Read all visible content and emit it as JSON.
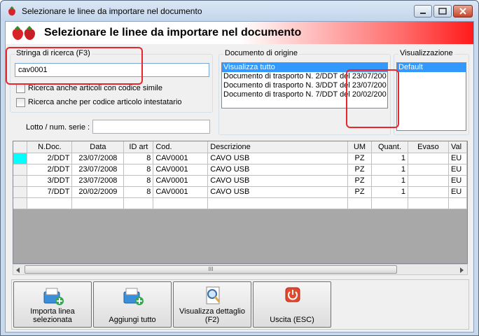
{
  "window": {
    "title": "Selezionare le linee da importare nel documento"
  },
  "banner": {
    "title": "Selezionare le linee da importare nel documento"
  },
  "search": {
    "label": "Stringa di ricerca (F3)",
    "value": "cav0001",
    "option1": "Ricerca anche articoli con codice simile",
    "option2": "Ricerca anche per codice articolo intestatario",
    "lot_label": "Lotto / num. serie :",
    "lot_value": ""
  },
  "origin": {
    "label": "Documento di origine",
    "items": [
      "Visualizza tutto",
      "Documento di trasporto N. 2/DDT del 23/07/200",
      "Documento di trasporto N. 3/DDT del 23/07/200",
      "Documento di trasporto N. 7/DDT del 20/02/200"
    ],
    "selected_index": 0
  },
  "view": {
    "label": "Visualizzazione",
    "items": [
      "Default"
    ],
    "selected_index": 0
  },
  "grid": {
    "columns": [
      "N.Doc.",
      "Data",
      "ID art",
      "Cod.",
      "Descrizione",
      "UM",
      "Quant.",
      "Evaso",
      "Val"
    ],
    "rows": [
      [
        "2/DDT",
        "23/07/2008",
        "8",
        "CAV0001",
        "CAVO USB",
        "PZ",
        "1",
        "",
        "EU"
      ],
      [
        "2/DDT",
        "23/07/2008",
        "8",
        "CAV0001",
        "CAVO USB",
        "PZ",
        "1",
        "",
        "EU"
      ],
      [
        "3/DDT",
        "23/07/2008",
        "8",
        "CAV0001",
        "CAVO USB",
        "PZ",
        "1",
        "",
        "EU"
      ],
      [
        "7/DDT",
        "20/02/2009",
        "8",
        "CAV0001",
        "CAVO USB",
        "PZ",
        "1",
        "",
        "EU"
      ]
    ]
  },
  "scroll": {
    "thumb_glyph": "III"
  },
  "toolbar": {
    "import_label": "Importa linea selezionata",
    "add_all_label": "Aggiungi tutto",
    "detail_label": "Visualizza dettaglio (F2)",
    "exit_label": "Uscita (ESC)"
  },
  "colors": {
    "highlight": "#e8262c",
    "selection": "#3399ff",
    "current_row": "#00ffff"
  }
}
